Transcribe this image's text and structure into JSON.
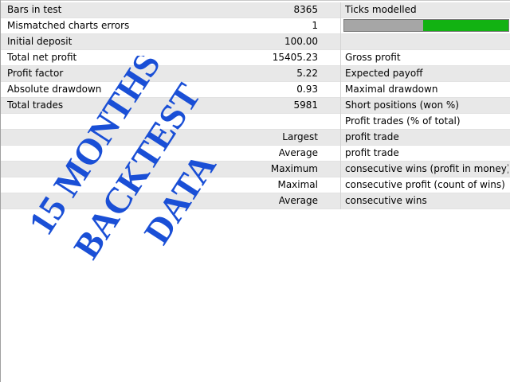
{
  "rows": [
    {
      "label": "Bars in test",
      "value": "8365",
      "label2": "Ticks modelled",
      "shade": true
    },
    {
      "label": "Mismatched charts errors",
      "value": "1",
      "label2": "",
      "shade": false,
      "has_progress": true
    },
    {
      "label": "Initial deposit",
      "value": "100.00",
      "label2": "",
      "shade": true
    },
    {
      "label": "Total net profit",
      "value": "15405.23",
      "label2": "Gross profit",
      "shade": false
    },
    {
      "label": "Profit factor",
      "value": "5.22",
      "label2": "Expected payoff",
      "shade": true
    },
    {
      "label": "Absolute drawdown",
      "value": "0.93",
      "label2": "Maximal drawdown",
      "shade": false
    },
    {
      "label": "Total trades",
      "value": "5981",
      "label2": "Short positions (won %)",
      "shade": true
    },
    {
      "label": "",
      "value": "",
      "label2": "Profit trades (% of total)",
      "shade": false
    },
    {
      "label": "",
      "value": "Largest",
      "label2": "profit trade",
      "shade": true
    },
    {
      "label": "",
      "value": "Average",
      "label2": "profit trade",
      "shade": false
    },
    {
      "label": "",
      "value": "Maximum",
      "label2": "consecutive wins (profit in money)",
      "shade": true
    },
    {
      "label": "",
      "value": "Maximal",
      "label2": "consecutive profit (count of wins)",
      "shade": false
    },
    {
      "label": "",
      "value": "Average",
      "label2": "consecutive wins",
      "shade": true
    }
  ],
  "progress": {
    "grey_fraction": 0.48,
    "green_fraction": 0.52,
    "grey_color": "#a6a6a6",
    "green_color": "#12b212"
  },
  "watermark": {
    "lines": [
      "15 MONTHS",
      "BACKTEST",
      "DATA"
    ],
    "color": "#1a4fd6"
  }
}
